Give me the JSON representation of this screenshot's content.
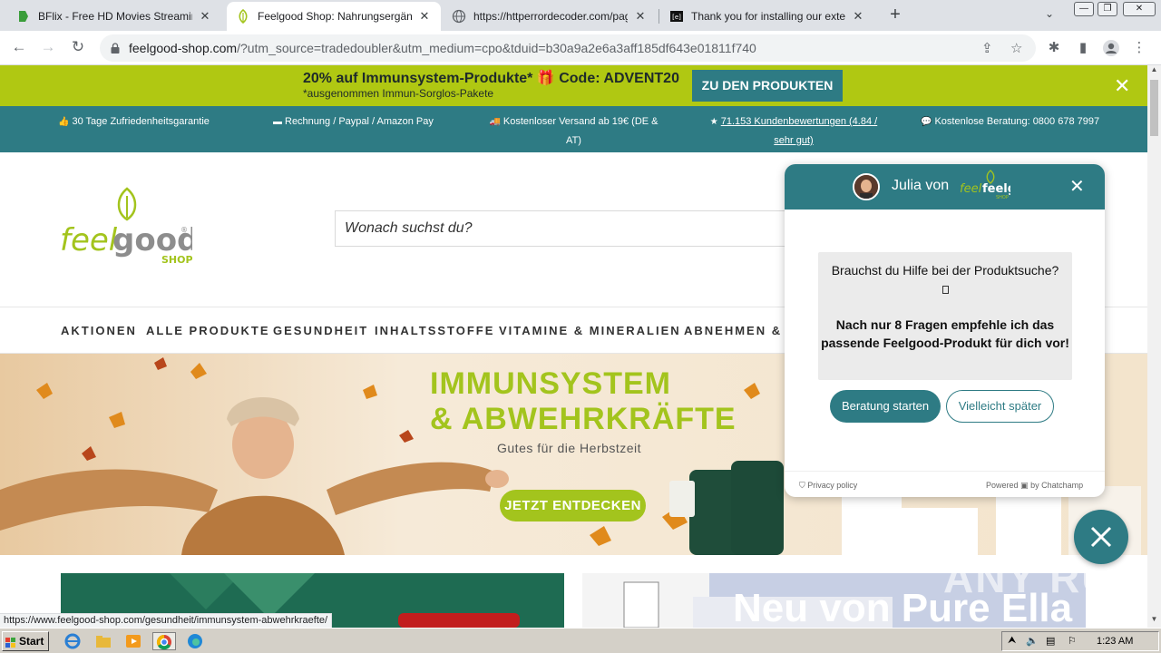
{
  "browser": {
    "tabs": [
      {
        "title": "BFlix - Free HD Movies Streaming - W",
        "icon": "bflix-favicon"
      },
      {
        "title": "Feelgood Shop: Nahrungsergänzung",
        "icon": "feelgood-favicon"
      },
      {
        "title": "https://httperrordecoder.com/page/",
        "icon": "globe-icon"
      },
      {
        "title": "Thank you for installing our extensio",
        "icon": "extension-favicon"
      }
    ],
    "url_host": "feelgood-shop.com",
    "url_rest": "/?utm_source=tradedoubler&utm_medium=cpo&tduid=b30a9a2e6a3aff185df643e01811f740"
  },
  "promo": {
    "headline": "20% auf Immunsystem-Produkte* 🎁 Code: ADVENT20",
    "note": "*ausgenommen Immun-Sorglos-Pakete",
    "button": "ZU DEN PRODUKTEN"
  },
  "usp": [
    {
      "icon": "thumbs-up-icon",
      "glyph": "👍",
      "text": "30 Tage Zufriedenheitsgarantie"
    },
    {
      "icon": "card-icon",
      "glyph": "▬",
      "text": "Rechnung / Paypal / Amazon Pay"
    },
    {
      "icon": "truck-icon",
      "glyph": "🚚",
      "text": "Kostenloser Versand ab 19€ (DE & AT)"
    },
    {
      "icon": "star-icon",
      "glyph": "★",
      "text": "71.153 Kundenbewertungen (4.84 / sehr gut)"
    },
    {
      "icon": "chat-icon",
      "glyph": "💬",
      "text": "Kostenlose Beratung: 0800 678 7997"
    }
  ],
  "header": {
    "logo_text": "feelgood",
    "logo_sub": "SHOP",
    "search_placeholder": "Wonach suchst du?"
  },
  "nav": [
    "AKTIONEN",
    "ALLE PRODUKTE",
    "GESUNDHEIT",
    "INHALTSSTOFFE",
    "VITAMINE & MINERALIEN",
    "ABNEHMEN & F"
  ],
  "hero": {
    "line1": "IMMUNSYSTEM",
    "line2": "& ABWEHRKRÄFTE",
    "sub": "Gutes für die Herbstzeit",
    "cta": "JETZT ENTDECKEN"
  },
  "tiles": {
    "right_title": "Neu von Pure Ella"
  },
  "chat": {
    "agent": "Julia von",
    "logo": "feelgood",
    "logo_sub": "SHOP",
    "question": "Brauchst du Hilfe bei der Produktsuche?",
    "offer": "Nach nur 8 Fragen empfehle ich das passende Feelgood-Produkt für dich vor!",
    "start_button": "Beratung starten",
    "later_button": "Vielleicht später",
    "privacy": "Privacy policy",
    "powered": "Powered",
    "powered_by": "by Chatchamp"
  },
  "status_url": "https://www.feelgood-shop.com/gesundheit/immunsystem-abwehrkraefte/",
  "watermark": "ANY RUN",
  "taskbar": {
    "start": "Start",
    "time": "1:23 AM"
  },
  "colors": {
    "brand_teal": "#2e7b84",
    "brand_green": "#a3c41d",
    "promo_bar": "#b0c812"
  }
}
